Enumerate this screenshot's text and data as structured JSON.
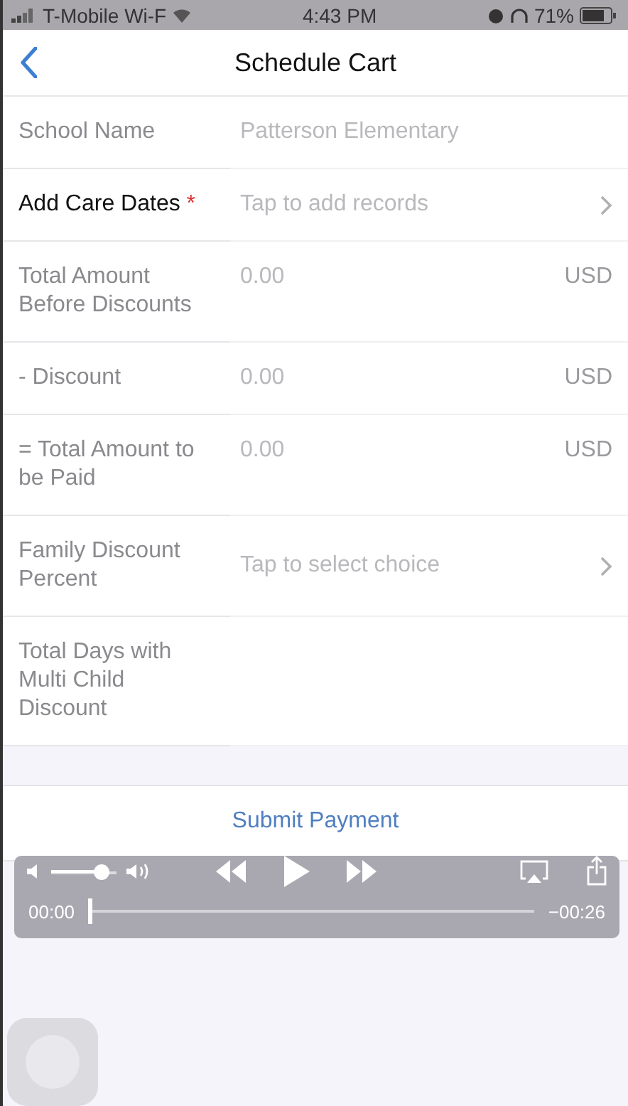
{
  "status_bar": {
    "carrier": "T-Mobile Wi-F",
    "time": "4:43 PM",
    "battery": "71%"
  },
  "nav": {
    "title": "Schedule Cart"
  },
  "rows": [
    {
      "label": "School Name",
      "kind": "text",
      "value": "Patterson Elementary"
    },
    {
      "label": "Add Care Dates",
      "required_mark": "*",
      "kind": "picker",
      "placeholder": "Tap to add records"
    },
    {
      "label": "Total Amount Before Discounts",
      "kind": "amount",
      "value": "0.00",
      "unit": "USD"
    },
    {
      "label": "- Discount",
      "kind": "amount",
      "value": "0.00",
      "unit": "USD"
    },
    {
      "label": "= Total Amount to be Paid",
      "kind": "amount",
      "value": "0.00",
      "unit": "USD"
    },
    {
      "label": "Family Discount Percent",
      "kind": "picker",
      "placeholder": "Tap to select choice"
    },
    {
      "label": "Total Days with Multi Child Discount",
      "kind": "text"
    }
  ],
  "submit": {
    "label": "Submit Payment"
  },
  "player": {
    "volume": {
      "level": 0.75
    },
    "progress": {
      "level": 0
    },
    "elapsed": "00:00",
    "remaining": "−00:26"
  }
}
